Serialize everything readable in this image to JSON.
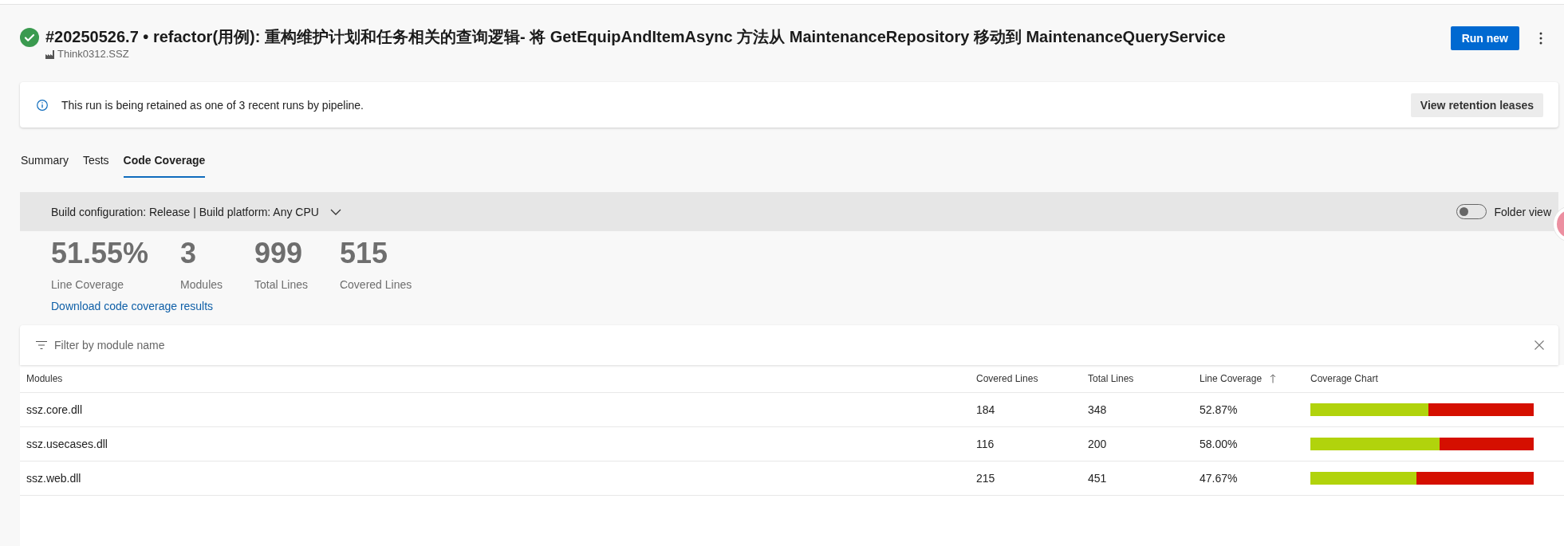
{
  "header": {
    "succeeded": true,
    "title": "#20250526.7 • refactor(用例): 重构维护计划和任务相关的查询逻辑- 将 GetEquipAndItemAsync 方法从 MaintenanceRepository 移动到 MaintenanceQueryService",
    "subtitle": "Think0312.SSZ",
    "run_button": "Run new"
  },
  "banner": {
    "message": "This run is being retained as one of 3 recent runs by pipeline.",
    "button": "View retention leases"
  },
  "tabs": [
    {
      "label": "Summary",
      "selected": false
    },
    {
      "label": "Tests",
      "selected": false
    },
    {
      "label": "Code Coverage",
      "selected": true
    }
  ],
  "config_bar": {
    "label": "Build configuration: Release | Build platform: Any CPU",
    "folder_view": {
      "label": "Folder view",
      "on": false
    }
  },
  "stats": [
    {
      "value": "51.55%",
      "label": "Line Coverage"
    },
    {
      "value": "3",
      "label": "Modules"
    },
    {
      "value": "999",
      "label": "Total Lines"
    },
    {
      "value": "515",
      "label": "Covered Lines"
    }
  ],
  "download_link": "Download code coverage results",
  "filter": {
    "placeholder": "Filter by module name"
  },
  "table": {
    "columns": [
      {
        "label": "Modules",
        "sorted": false
      },
      {
        "label": "Covered Lines",
        "sorted": false
      },
      {
        "label": "Total Lines",
        "sorted": false
      },
      {
        "label": "Line Coverage",
        "sorted": true
      },
      {
        "label": "Coverage Chart",
        "sorted": false
      }
    ],
    "rows": [
      {
        "module": "ssz.core.dll",
        "covered_lines": "184",
        "total_lines": "348",
        "line_coverage": "52.87%",
        "level": 0.5287
      },
      {
        "module": "ssz.usecases.dll",
        "covered_lines": "116",
        "total_lines": "200",
        "line_coverage": "58.00%",
        "level": 0.58
      },
      {
        "module": "ssz.web.dll",
        "covered_lines": "215",
        "total_lines": "451",
        "line_coverage": "47.67%",
        "level": 0.4767
      }
    ]
  }
}
